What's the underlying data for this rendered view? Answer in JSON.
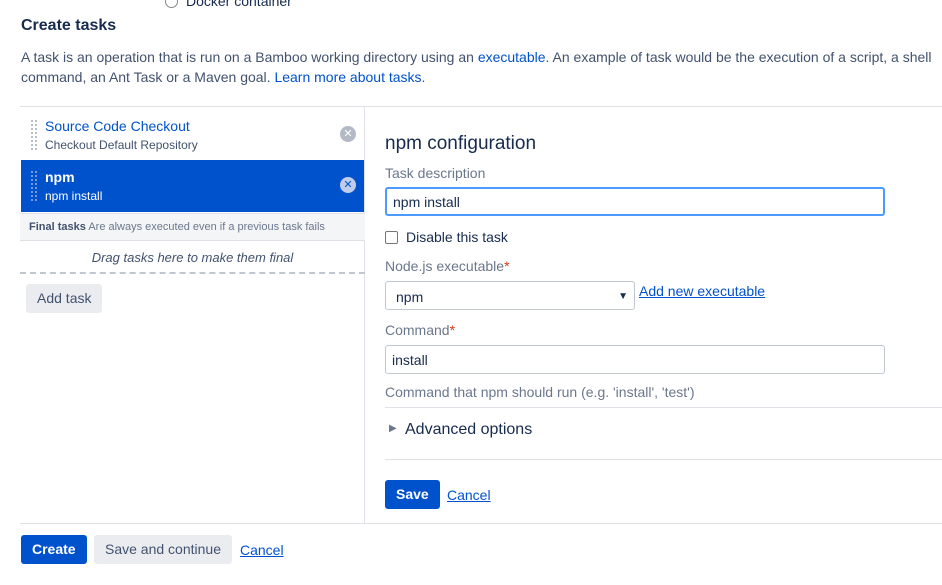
{
  "top_cutoff": {
    "radio_label": "Docker container"
  },
  "section": {
    "title": "Create tasks",
    "intro_part1": "A task is an operation that is run on a Bamboo working directory using an ",
    "intro_link1": "executable",
    "intro_part2": ". An example of task would be the execution of a script, a shell command, an Ant Task or a Maven goal. ",
    "intro_link2": "Learn more about tasks",
    "intro_part3": "."
  },
  "tasks": [
    {
      "title": "Source Code Checkout",
      "subtitle": "Checkout Default Repository",
      "selected": false
    },
    {
      "title": "npm",
      "subtitle": "npm install",
      "selected": true
    }
  ],
  "final_tasks": {
    "label": "Final tasks",
    "note": "Are always executed even if a previous task fails",
    "drop_hint": "Drag tasks here to make them final"
  },
  "add_task_label": "Add task",
  "config": {
    "title": "npm configuration",
    "task_description_label": "Task description",
    "task_description_value": "npm install",
    "disable_label": "Disable this task",
    "executable_label": "Node.js executable",
    "executable_value": "npm",
    "add_executable_link": "Add new executable",
    "command_label": "Command",
    "command_value": "install",
    "command_help": "Command that npm should run (e.g. 'install', 'test')",
    "advanced_label": "Advanced options",
    "required_marker": "*",
    "save_label": "Save",
    "cancel_label": "Cancel"
  },
  "footer": {
    "create_label": "Create",
    "save_continue_label": "Save and continue",
    "cancel_label": "Cancel"
  },
  "colors": {
    "primary": "#0052cc",
    "selected_row": "#0052cc",
    "focus_ring": "#4c9aff",
    "required": "#de350b"
  },
  "icons": {
    "remove": "remove-circle-icon",
    "drag": "drag-grip-icon",
    "caret": "chevron-down-icon",
    "expand": "chevron-right-icon"
  }
}
